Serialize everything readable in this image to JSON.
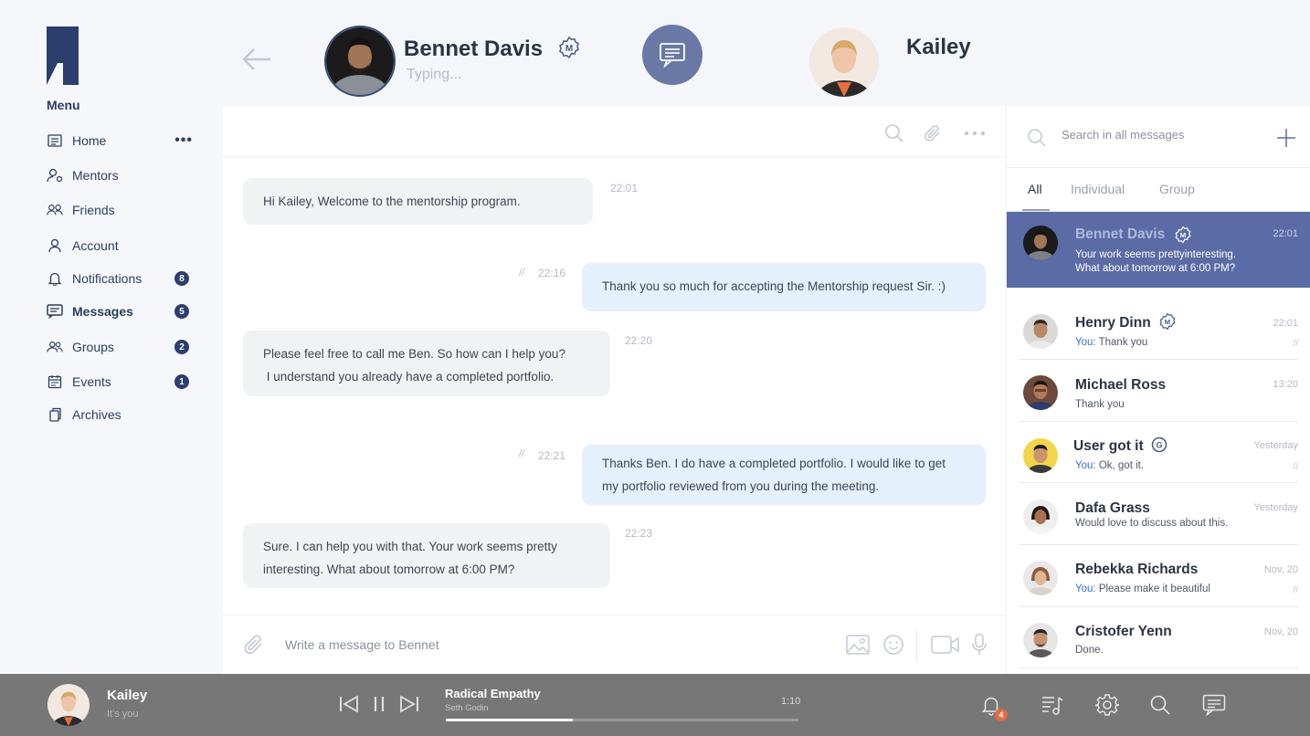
{
  "colors": {
    "brand": "#2c3e6d",
    "accent": "#5a6ba5",
    "header_circle": "#6a78a6",
    "outgoing_bubble": "#e5f0fd",
    "incoming_bubble": "#f1f2f4",
    "player_bg": "#777777",
    "badge_orange": "#e46a3d"
  },
  "sidebar": {
    "menu_title": "Menu",
    "items": [
      {
        "label": "Home",
        "icon": "home-icon",
        "extra": "•••"
      },
      {
        "label": "Mentors",
        "icon": "mentor-icon"
      },
      {
        "label": "Friends",
        "icon": "friends-icon"
      },
      {
        "label": "Account",
        "icon": "account-icon"
      },
      {
        "label": "Notifications",
        "icon": "bell-icon",
        "badge": "8"
      },
      {
        "label": "Messages",
        "icon": "messages-icon",
        "badge": "5"
      },
      {
        "label": "Groups",
        "icon": "groups-icon",
        "badge": "2"
      },
      {
        "label": "Events",
        "icon": "calendar-icon",
        "badge": "1"
      },
      {
        "label": "Archives",
        "icon": "archive-icon"
      }
    ]
  },
  "header": {
    "contact_name": "Bennet Davis",
    "contact_status": "Typing...",
    "me_name": "Kailey"
  },
  "chat": {
    "messages": [
      {
        "dir": "in",
        "text": "Hi Kailey, Welcome to the mentorship program.",
        "time": "22:01"
      },
      {
        "dir": "out",
        "text": "Thank you so much for accepting the Mentorship request Sir.  :)",
        "time": "22:16",
        "tick": "//"
      },
      {
        "dir": "in",
        "line1": "Please feel free to call me Ben. So how can I help you?",
        "line2": " I understand you already have a completed portfolio.",
        "time": "22:20"
      },
      {
        "dir": "out",
        "line1": "Thanks Ben. I do have a completed portfolio. I would like to get",
        "line2": "my portfolio reviewed from you during the meeting.",
        "time": "22:21",
        "tick": "//"
      },
      {
        "dir": "in",
        "line1": "Sure. I can help you with that. Your work seems pretty",
        "line2": "interesting. What about tomorrow at 6:00 PM?",
        "time": "22:23"
      }
    ],
    "compose_placeholder": "Write a message to Bennet"
  },
  "panel": {
    "search_placeholder": "Search in all messages",
    "tabs": [
      "All",
      "Individual",
      "Group"
    ],
    "conversations": [
      {
        "name": "Bennet Davis",
        "badge": "M",
        "time": "22:01",
        "preview_line1": "Your work seems prettyinteresting.",
        "preview_line2": "What about tomorrow at 6:00 PM?",
        "selected": true
      },
      {
        "name": "Henry Dinn",
        "badge": "M",
        "time": "22:01",
        "you": "You:",
        "preview": "Thank you",
        "tick": "//"
      },
      {
        "name": "Michael Ross",
        "time": "13:20",
        "preview": "Thank you"
      },
      {
        "name": "User got it",
        "badge": "G",
        "time": "Yesterday",
        "you": "You:",
        "preview": "Ok, got it.",
        "tick": "//"
      },
      {
        "name": "Dafa Grass",
        "time": "Yesterday",
        "preview": "Would love to discuss about this."
      },
      {
        "name": "Rebekka Richards",
        "time": "Nov, 20",
        "you": "You:",
        "preview": "Please make it beautiful",
        "tick": "//"
      },
      {
        "name": "Cristofer Yenn",
        "time": "Nov, 20",
        "preview": "Done."
      }
    ]
  },
  "player": {
    "user_name": "Kailey",
    "user_sub": "It's you",
    "track": "Radical Empathy",
    "artist": "Seth Godin",
    "elapsed": "1:10",
    "progress": 0.36,
    "bell_badge": "4"
  }
}
